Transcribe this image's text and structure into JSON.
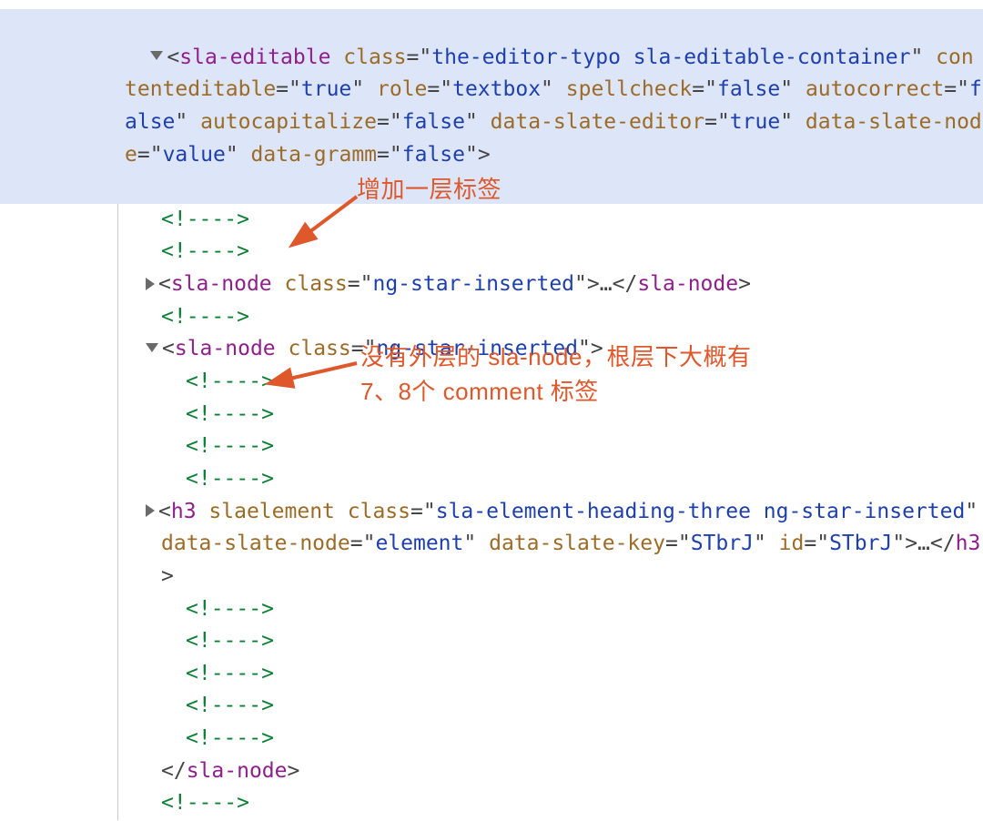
{
  "root": {
    "tag": "sla-editable",
    "cls": "the-editor-typo sla-editable-container",
    "attrs": {
      "contenteditable": "true",
      "role": "textbox",
      "spellcheck": "false",
      "autocorrect": "false",
      "autocapitalize": "false",
      "data-slate-editor": "true",
      "data-slate-node": "value",
      "data-gramm": "false"
    }
  },
  "comment": "<!---->",
  "node_tag": "sla-node",
  "node_cls": "ng-star-inserted",
  "h3": {
    "tag": "h3",
    "extra": "slaelement",
    "cls": "sla-element-heading-three ng-star-inserted",
    "dsn": "element",
    "dsk": "STbrJ",
    "id": "STbrJ"
  },
  "ellipsis": "…",
  "class_kw": "class",
  "id_kw": "id",
  "attr_names": {
    "contenteditable": "contenteditable",
    "role": "role",
    "spellcheck": "spellcheck",
    "autocorrect": "autocorrect",
    "autocapitalize": "autocapitalize",
    "dse": "data-slate-editor",
    "dsn": "data-slate-node",
    "dg": "data-gramm",
    "dsk": "data-slate-key"
  },
  "anno1": "增加一层标签",
  "anno2_l1": "没有外层的 sla-node，根层下大概有",
  "anno2_l2": "7、8个 comment 标签"
}
